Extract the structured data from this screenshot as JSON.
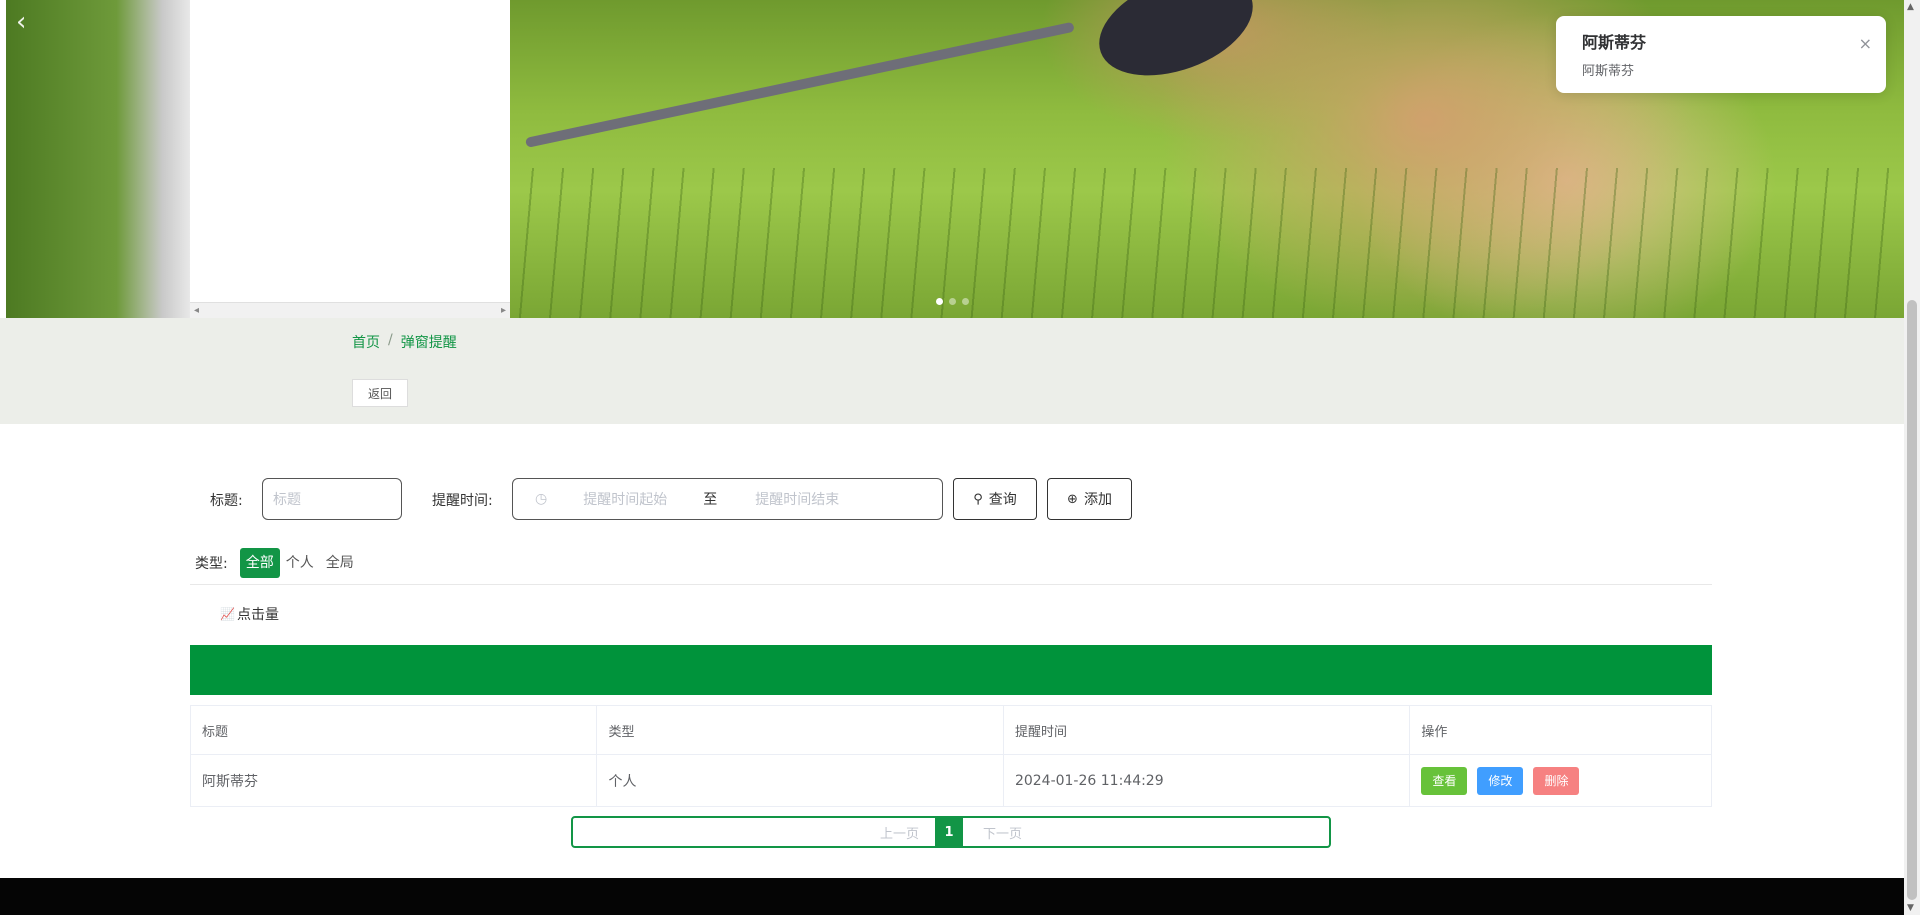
{
  "notification": {
    "title": "阿斯蒂芬",
    "message": "阿斯蒂芬",
    "close": "×"
  },
  "breadcrumb": {
    "home": "首页",
    "separator": "/",
    "current": "弹窗提醒"
  },
  "back_label": "返回",
  "search": {
    "title_label": "标题:",
    "title_placeholder": "标题",
    "time_label": "提醒时间:",
    "time_start_placeholder": "提醒时间起始",
    "time_to": "至",
    "time_end_placeholder": "提醒时间结束",
    "query_label": "查询",
    "add_label": "添加"
  },
  "types": {
    "label": "类型:",
    "options": [
      "全部",
      "个人",
      "全局"
    ],
    "active": "全部"
  },
  "stats_label": "点击量",
  "table": {
    "headers": [
      "标题",
      "类型",
      "提醒时间",
      "操作"
    ],
    "rows": [
      {
        "title": "阿斯蒂芬",
        "type": "个人",
        "time": "2024-01-26 11:44:29"
      }
    ],
    "actions": {
      "view": "查看",
      "edit": "修改",
      "delete": "删除"
    }
  },
  "pagination": {
    "prev": "上一页",
    "current": "1",
    "next": "下一页"
  },
  "colors": {
    "brand_green": "#129546",
    "bar_green": "#00933b",
    "view": "#67c23a",
    "edit": "#409eff",
    "delete": "#f56c6c"
  },
  "icons": [
    "chevron-left-icon",
    "close-icon",
    "clock-icon",
    "search-icon",
    "plus-circle-icon",
    "chart-icon"
  ]
}
